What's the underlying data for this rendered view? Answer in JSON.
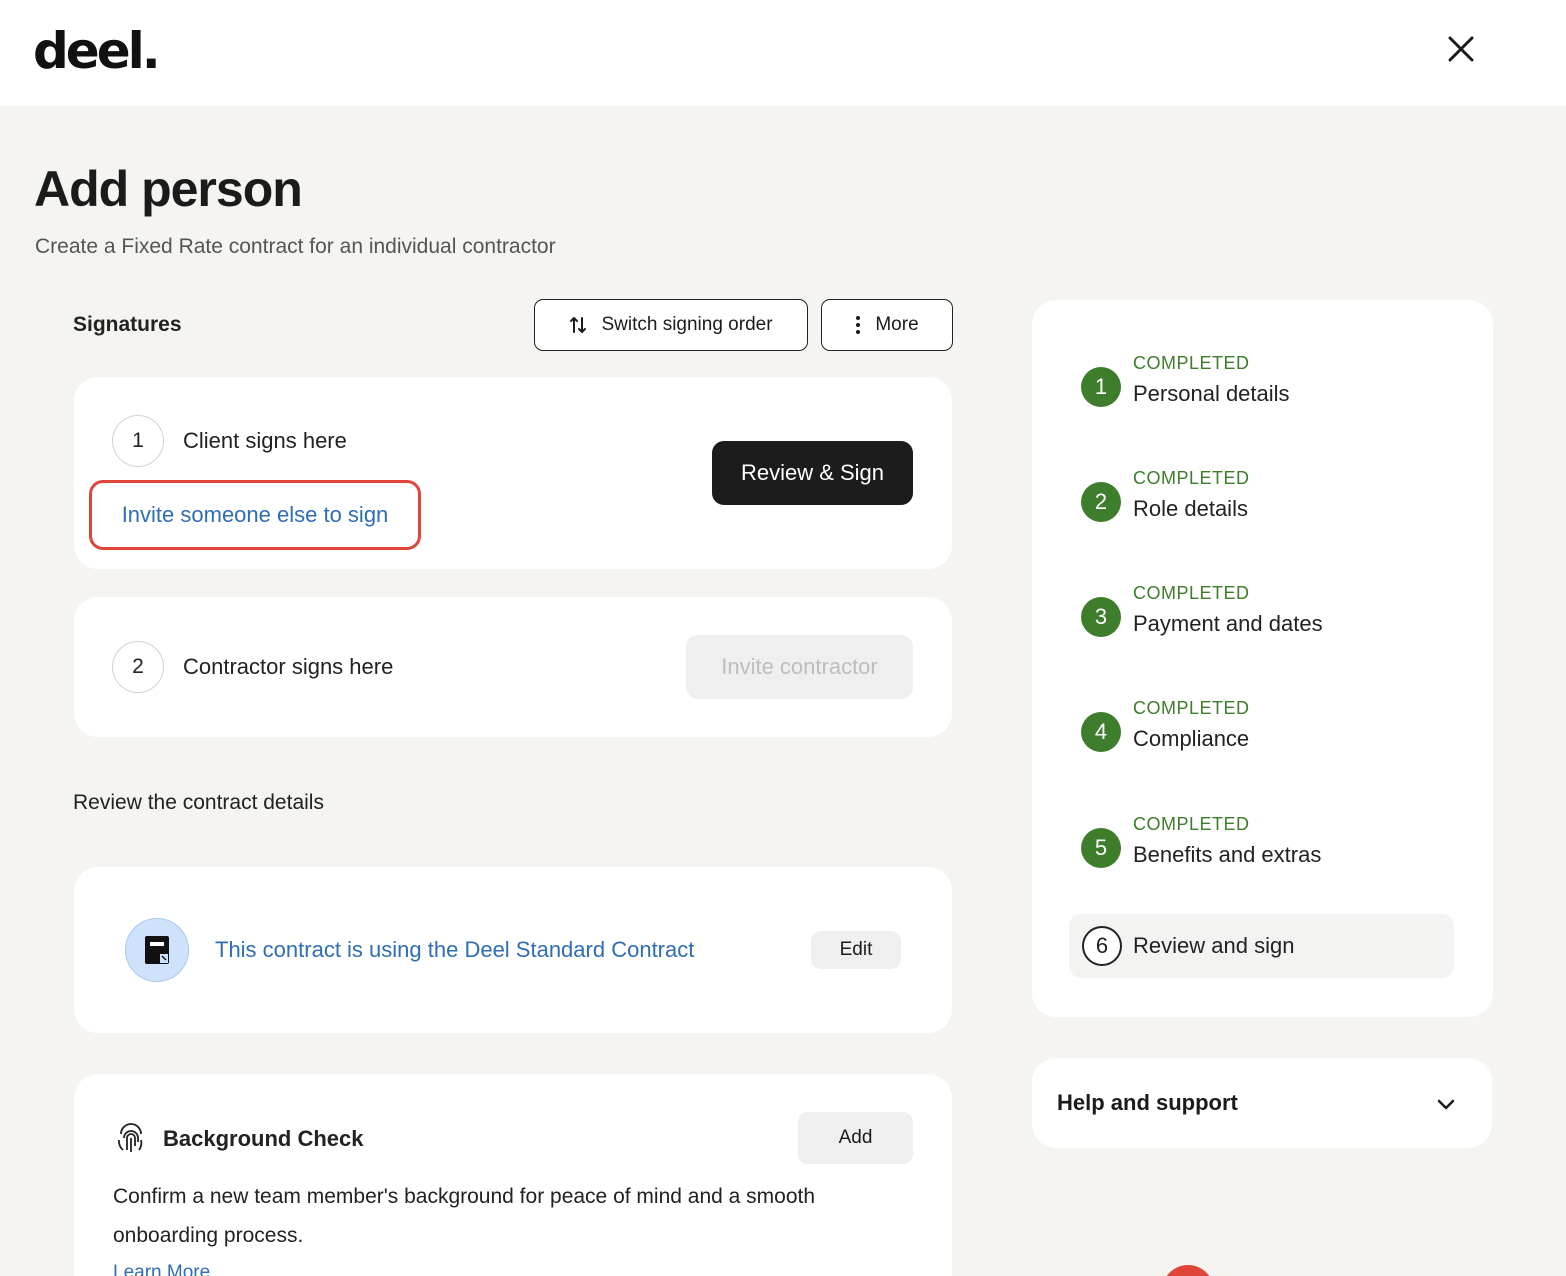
{
  "app": {
    "logo": "deel."
  },
  "header": {
    "close_icon": "close-icon"
  },
  "page": {
    "title": "Add person",
    "subtitle": "Create a Fixed Rate contract for an individual contractor"
  },
  "signatures": {
    "title": "Signatures",
    "switch_order_label": "Switch signing order",
    "more_label": "More",
    "client": {
      "number": "1",
      "label": "Client signs here",
      "invite_link": "Invite someone else to sign",
      "action_label": "Review & Sign"
    },
    "contractor": {
      "number": "2",
      "label": "Contractor signs here",
      "action_label": "Invite contractor"
    }
  },
  "review": {
    "title": "Review the contract details",
    "contract_link": "This contract is using the Deel Standard Contract",
    "edit_label": "Edit"
  },
  "background_check": {
    "title": "Background Check",
    "add_label": "Add",
    "description": "Confirm a new team member's background for peace of mind and a smooth onboarding process.",
    "learn_more": "Learn More"
  },
  "progress": {
    "steps": [
      {
        "number": "1",
        "status": "COMPLETED",
        "label": "Personal details"
      },
      {
        "number": "2",
        "status": "COMPLETED",
        "label": "Role details"
      },
      {
        "number": "3",
        "status": "COMPLETED",
        "label": "Payment and dates"
      },
      {
        "number": "4",
        "status": "COMPLETED",
        "label": "Compliance"
      },
      {
        "number": "5",
        "status": "COMPLETED",
        "label": "Benefits and extras"
      }
    ],
    "current": {
      "number": "6",
      "label": "Review and sign"
    }
  },
  "help": {
    "title": "Help and support"
  },
  "colors": {
    "accent_green": "#3d7d2b",
    "link_blue": "#2f6db5",
    "highlight_red": "#e0453a",
    "primary_dark": "#1c1c1c"
  }
}
